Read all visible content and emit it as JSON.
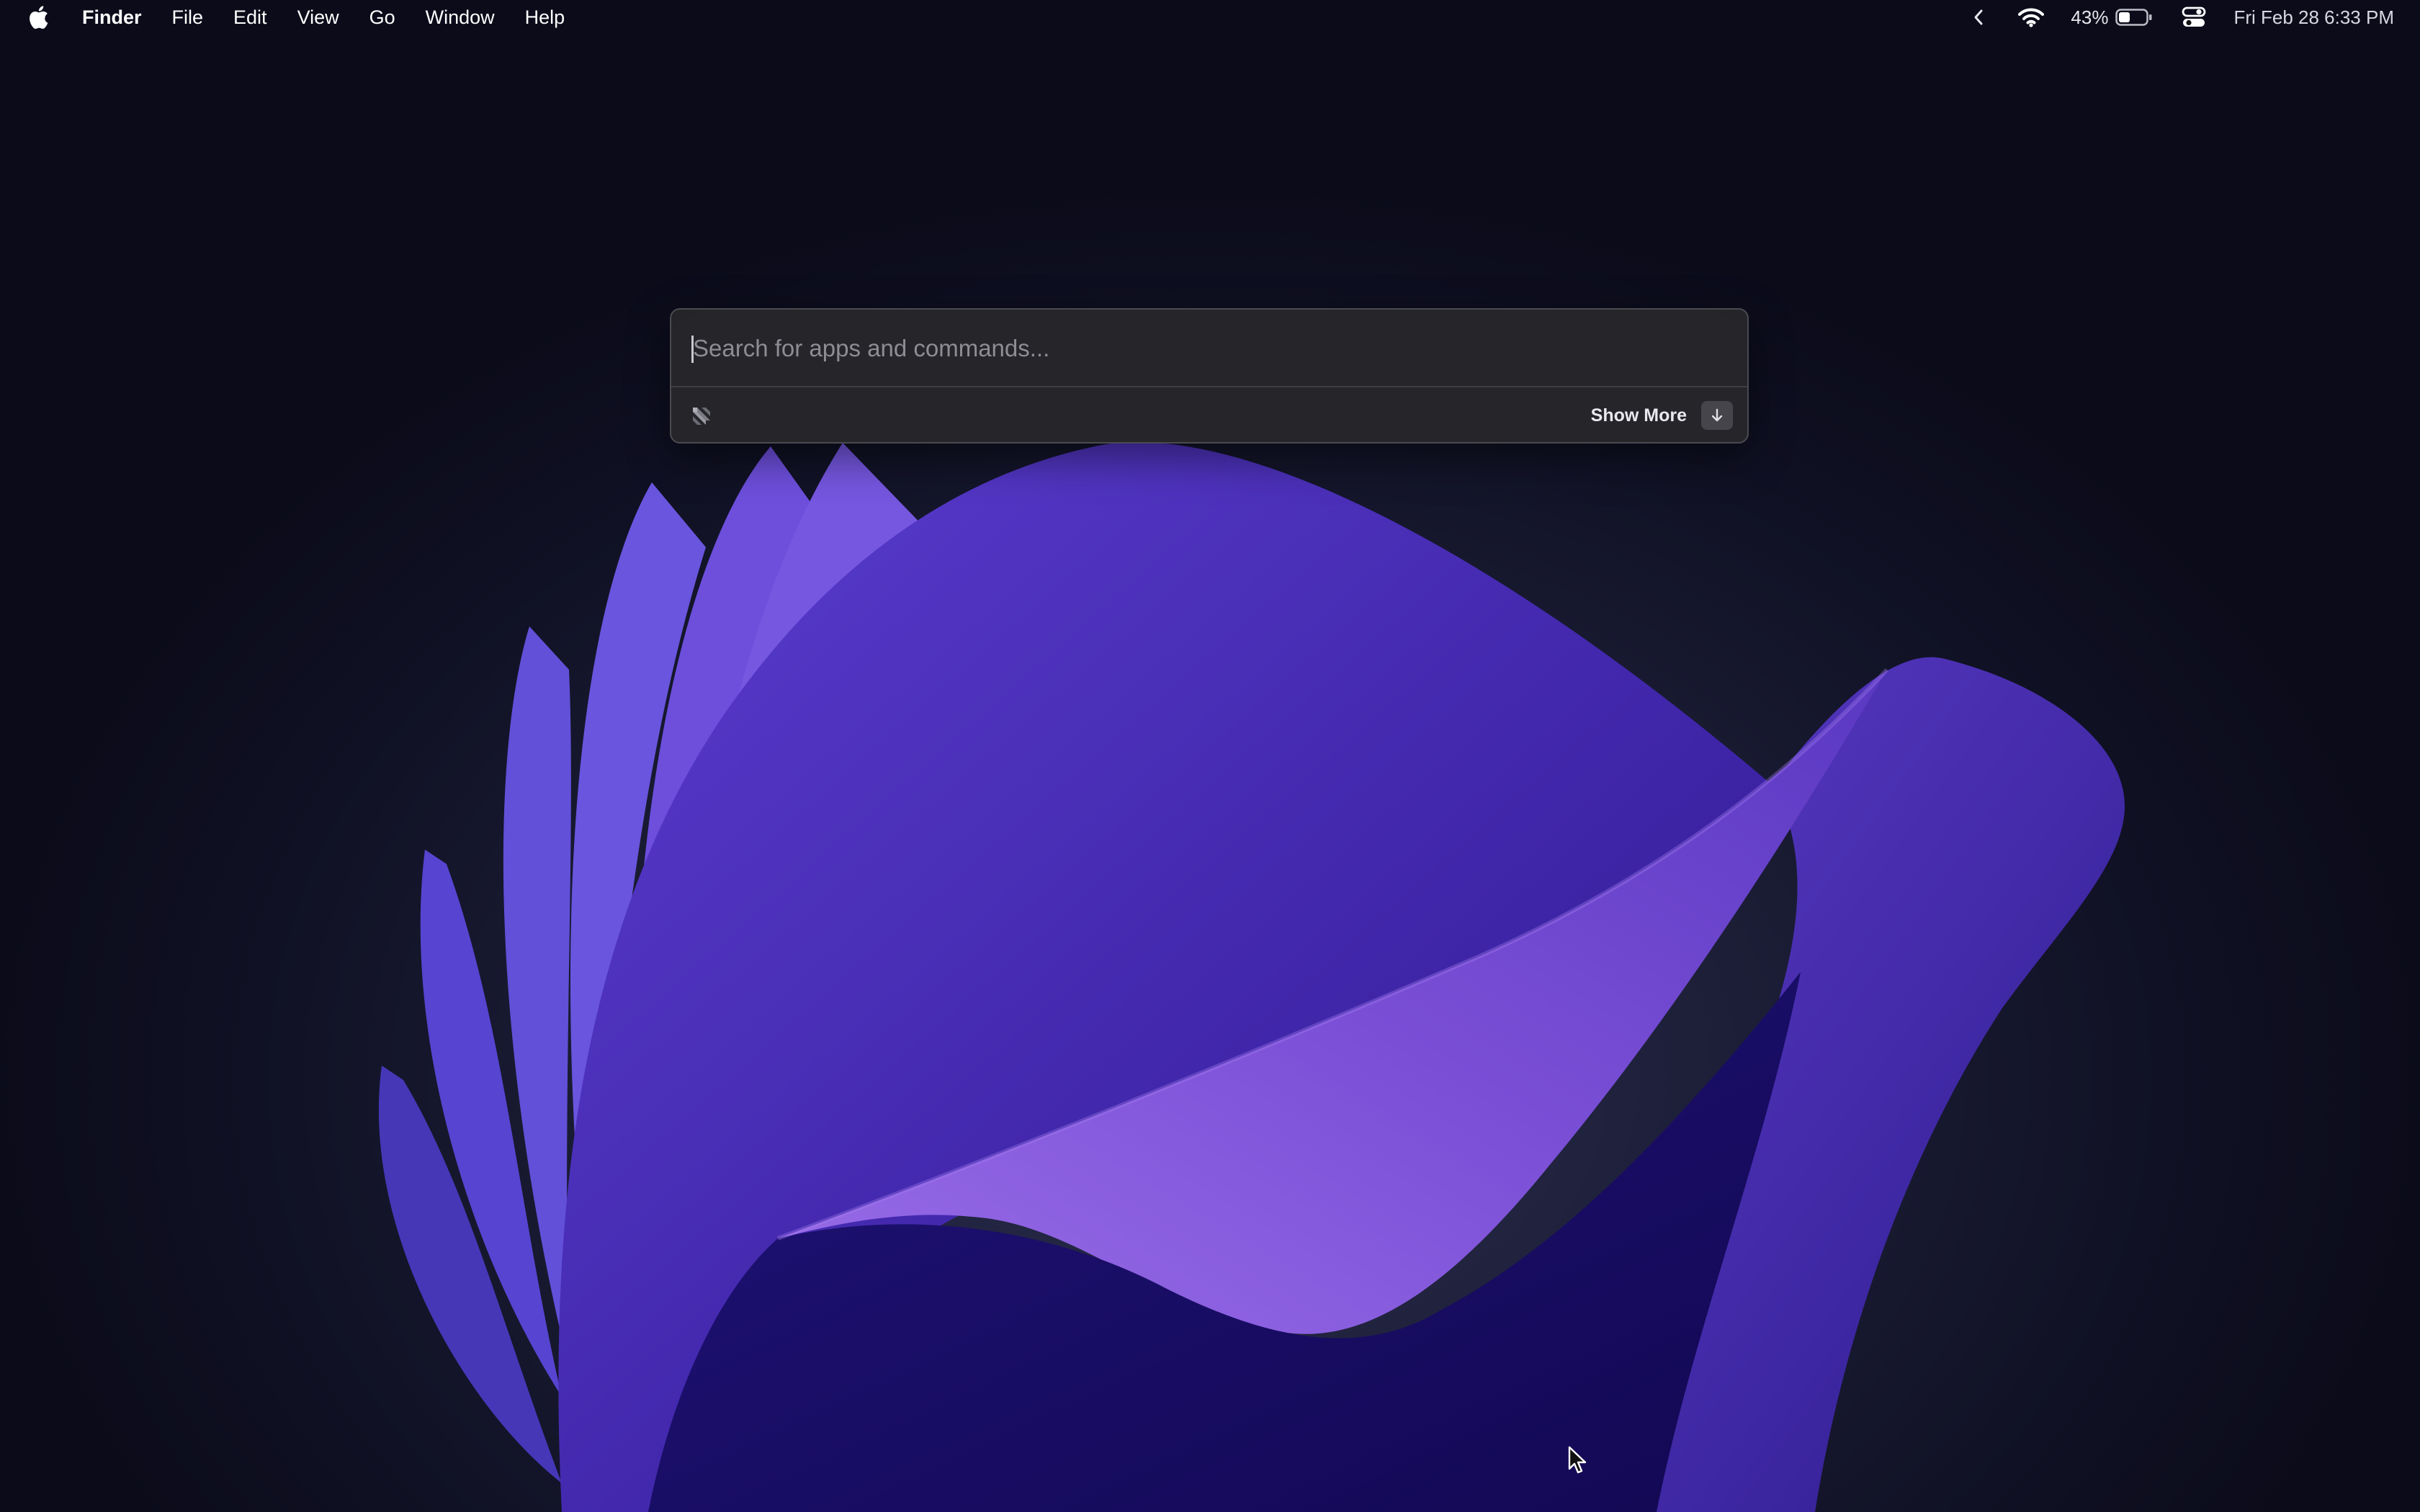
{
  "menubar": {
    "apple_icon": "apple-logo-icon",
    "app_name": "Finder",
    "items": [
      "File",
      "Edit",
      "View",
      "Go",
      "Window",
      "Help"
    ],
    "status": {
      "overflow_icon": "chevron-left-icon",
      "wifi_icon": "wifi-icon",
      "battery_percent": "43%",
      "battery_level": 0.43,
      "battery_icon": "battery-icon",
      "control_center_icon": "control-center-icon",
      "datetime": "Fri Feb 28  6:33 PM"
    }
  },
  "launcher": {
    "search": {
      "value": "",
      "placeholder": "Search for apps and commands..."
    },
    "app_icon": "raycast-icon",
    "show_more_label": "Show More",
    "show_more_key_icon": "arrow-down-icon"
  },
  "colors": {
    "wallpaper_dark": "#0f1022",
    "petal_purple": "#5a35c8",
    "petal_light": "#8a5ee0",
    "panel_bg": "#26262a"
  }
}
